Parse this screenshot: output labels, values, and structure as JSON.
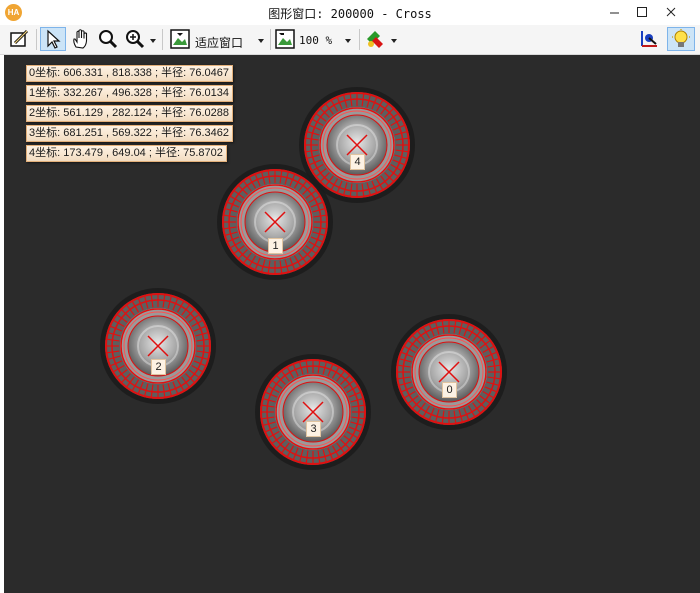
{
  "window": {
    "title": "图形窗口: 200000 - Cross",
    "app_icon_text": "HA"
  },
  "toolbar": {
    "fit_window_label": "适应窗口",
    "zoom_value": "100 %"
  },
  "results": [
    {
      "text": "0坐标: 606.331 , 818.338 ; 半径: 76.0467",
      "index": "0"
    },
    {
      "text": "1坐标: 332.267 , 496.328 ; 半径: 76.0134",
      "index": "1"
    },
    {
      "text": "2坐标: 561.129 , 282.124 ; 半径: 76.0288",
      "index": "2"
    },
    {
      "text": "3坐标: 681.251 , 569.322 ; 半径: 76.3462",
      "index": "3"
    },
    {
      "text": "4坐标: 173.479 , 649.04 ; 半径: 75.8702",
      "index": "4"
    }
  ],
  "colors": {
    "canvas_bg": "#2b2b2b",
    "overlay": "#e01010",
    "label_bg": "#fdf2e4",
    "label_border": "#e3b07a"
  }
}
